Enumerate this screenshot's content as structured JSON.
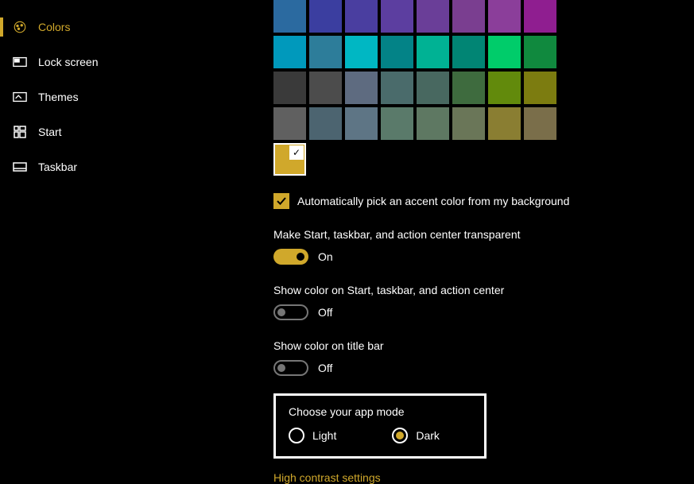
{
  "accent": "#d0a82b",
  "sidebar": {
    "items": [
      {
        "label": "Colors",
        "active": true
      },
      {
        "label": "Lock screen",
        "active": false
      },
      {
        "label": "Themes",
        "active": false
      },
      {
        "label": "Start",
        "active": false
      },
      {
        "label": "Taskbar",
        "active": false
      }
    ]
  },
  "color_swatches": {
    "rows": [
      [
        "#2b6aa0",
        "#3b3ea0",
        "#4a3ea0",
        "#5c3ea0",
        "#6a3e98",
        "#7a3e90",
        "#8b3e9a",
        "#8f1e90"
      ],
      [
        "#0099bc",
        "#2d7d9a",
        "#00b7c3",
        "#038387",
        "#00b294",
        "#018574",
        "#00cc6a",
        "#10893e"
      ],
      [
        "#3a3a3a",
        "#4c4c4c",
        "#5e6b80",
        "#4a6b6b",
        "#486860",
        "#3e6b3e",
        "#628a0c",
        "#7c7c10"
      ],
      [
        "#606060",
        "#4c6470",
        "#5e7585",
        "#5a7a6a",
        "#5e7862",
        "#6a7658",
        "#8a7e32",
        "#7a6e4a"
      ]
    ],
    "selected": "#d0a82b"
  },
  "checkbox": {
    "auto_accent_label": "Automatically pick an accent color from my background",
    "checked": true
  },
  "toggles": {
    "transparent": {
      "label": "Make Start, taskbar, and action center transparent",
      "state_label": "On",
      "on": true
    },
    "show_color": {
      "label": "Show color on Start, taskbar, and action center",
      "state_label": "Off",
      "on": false
    },
    "title_bar": {
      "label": "Show color on title bar",
      "state_label": "Off",
      "on": false
    }
  },
  "app_mode": {
    "heading": "Choose your app mode",
    "options": {
      "light": "Light",
      "dark": "Dark"
    },
    "selected": "dark"
  },
  "link": {
    "high_contrast": "High contrast settings"
  }
}
